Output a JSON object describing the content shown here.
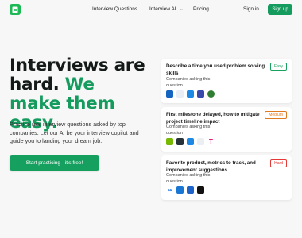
{
  "nav": {
    "links": [
      "Interview Questions",
      "Interview AI",
      "Pricing"
    ],
    "sign_in": "Sign in",
    "sign_up": "Sign up"
  },
  "hero": {
    "title_plain": "Interviews are hard.",
    "title_accent": "We make them easy.",
    "subtitle": "Practice real interview questions asked by top companies. Let our AI be your interview copilot and guide you to landing your dream job.",
    "cta": "Start practicing - it's free!"
  },
  "cards": [
    {
      "question": "Describe a time you used problem solving skills",
      "difficulty": "Easy",
      "difficulty_color": "#1aa15f",
      "asking_label": "Companies asking this question",
      "companies": [
        {
          "icon": "company-logo-blue-circle",
          "glyph": "",
          "color": "#1565c0"
        },
        {
          "icon": "company-logo-light-wordmark",
          "glyph": "",
          "color": "#e9eef5"
        },
        {
          "icon": "company-logo-cyan",
          "glyph": "",
          "color": "#1e88e5"
        },
        {
          "icon": "company-logo-navy",
          "glyph": "",
          "color": "#3949ab"
        },
        {
          "icon": "company-logo-green-emblem",
          "glyph": "",
          "color": "#2e7d32"
        }
      ]
    },
    {
      "question": "First milestone delayed, how to mitigate project timeline impact",
      "difficulty": "Medium",
      "difficulty_color": "#e07a1f",
      "asking_label": "Companies asking this question",
      "companies": [
        {
          "icon": "company-logo-green",
          "glyph": "",
          "color": "#76b900"
        },
        {
          "icon": "company-logo-dark",
          "glyph": "",
          "color": "#263238"
        },
        {
          "icon": "company-logo-blue",
          "glyph": "",
          "color": "#1e88e5"
        },
        {
          "icon": "company-logo-grid",
          "glyph": "",
          "color": "#eceff1"
        },
        {
          "icon": "company-logo-t-magenta",
          "glyph": "T",
          "color": "#e20074"
        }
      ]
    },
    {
      "question": "Favorite product, metrics to track, and improvement suggestions",
      "difficulty": "Hard",
      "difficulty_color": "#e53935",
      "asking_label": "Companies asking this question",
      "companies": [
        {
          "icon": "company-logo-meta",
          "glyph": "∞",
          "color": "#ffffff"
        },
        {
          "icon": "company-logo-blue-square",
          "glyph": "",
          "color": "#1976d2"
        },
        {
          "icon": "company-logo-blue-mark",
          "glyph": "",
          "color": "#1e63c8"
        },
        {
          "icon": "company-logo-black",
          "glyph": "",
          "color": "#111111"
        }
      ]
    }
  ]
}
